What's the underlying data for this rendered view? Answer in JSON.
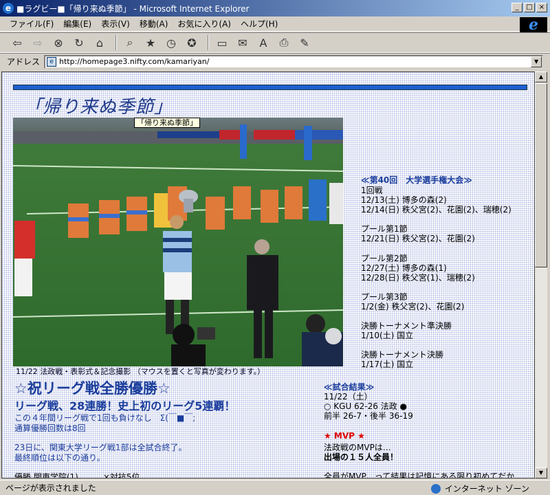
{
  "window": {
    "title": "■ラグビー■「帰り来ぬ季節」 - Microsoft Internet Explorer",
    "min_label": "_",
    "max_label": "□",
    "close_label": "×"
  },
  "menu": [
    "ファイル(F)",
    "編集(E)",
    "表示(V)",
    "移動(A)",
    "お気に入り(A)",
    "ヘルプ(H)"
  ],
  "address": {
    "label": "アドレス",
    "url": "http://homepage3.nifty.com/kamariyan/"
  },
  "status": {
    "text": "ページが表示されました",
    "zone": "インターネット ゾーン"
  },
  "page": {
    "title": "「帰り来ぬ季節」",
    "tooltip": "「帰り来ぬ季節」",
    "photo_caption": "11/22 法政戦・表彰式＆記念撮影 （マウスを置くと写真が変わります。）",
    "headline": "☆祝リーグ戦全勝優勝☆",
    "subheadline": "リーグ戦、28連勝！史上初のリーグ5連覇！",
    "line1": "この４年間リーグ戦で1回も負けなし　Σ(￣■￣;",
    "line2": "通算優勝回数は8回",
    "line3": "23日に、関東大学リーグ戦1部は全試合終了。",
    "line4": "最終順位は以下の通り。",
    "standings_first": "優勝 関東学院(1)　　　×対抗5位",
    "tournament": {
      "heading": "≪第40回　大学選手権大会≫",
      "lines": [
        "1回戦",
        "12/13(土) 博多の森(2)",
        "12/14(日) 秩父宮(2)、花園(2)、瑞穂(2)",
        "",
        "プール第1節",
        "12/21(日) 秩父宮(2)、花園(2)",
        "",
        "プール第2節",
        "12/27(土) 博多の森(1)",
        "12/28(日) 秩父宮(1)、瑞穂(2)",
        "",
        "プール第3節",
        "1/2(金) 秩父宮(2)、花園(2)",
        "",
        "決勝トーナメント準決勝",
        "1/10(土) 国立",
        "",
        "決勝トーナメント決勝",
        "1/17(土) 国立"
      ]
    },
    "result": {
      "heading": "≪試合結果≫",
      "date": "11/22（土）",
      "score": "○ KGU 62-26 法政 ●",
      "halves": "前半  26-7・後半  36-19"
    },
    "mvp": {
      "heading": "★ MVP ★",
      "line1": "法政戦のMVPは…",
      "line2": "出場の１５人全員！",
      "line3": "全員がMVP、って結果は記憶にある限り初めてだか"
    }
  }
}
